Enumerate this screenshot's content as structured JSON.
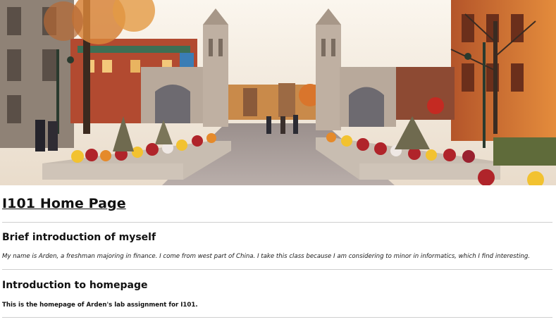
{
  "hero": {
    "image": "campus-gateway-photo",
    "colors": {
      "sky": "#f3efe6",
      "stone": "#b9a99a",
      "brick": "#a4452f",
      "foliage_orange": "#e58a2a",
      "flowers_red": "#b0242a",
      "flowers_yellow": "#f2c230"
    }
  },
  "page": {
    "title": "I101 Home Page"
  },
  "sections": [
    {
      "heading": "Brief introduction of myself",
      "body": "My name is Arden, a freshman majoring in finance. I come from west part of China. I take this class because I am considering to minor in informatics, which I find interesting."
    },
    {
      "heading": "Introduction to homepage",
      "body": "This is the homepage of Arden's lab assignment for I101."
    }
  ]
}
